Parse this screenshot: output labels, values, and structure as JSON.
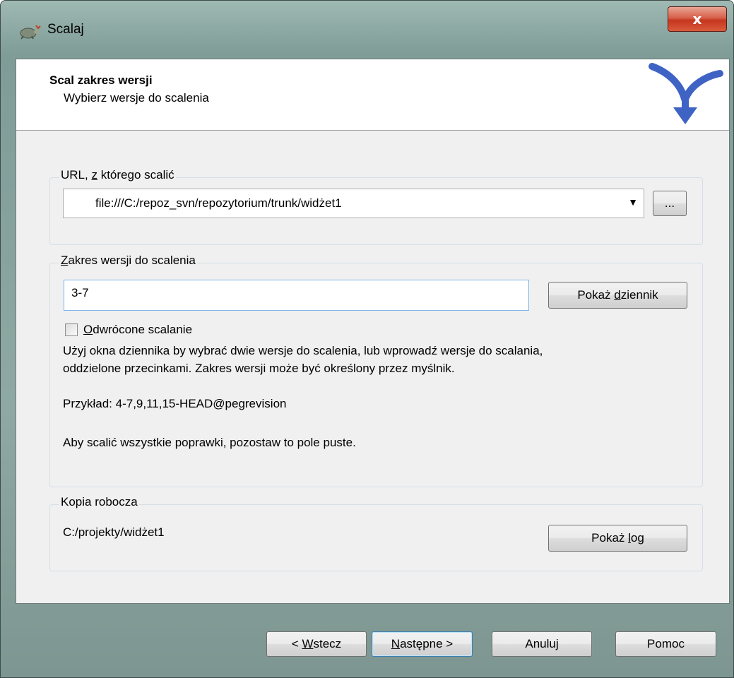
{
  "window": {
    "title": "Scalaj",
    "close_label": "x"
  },
  "header": {
    "title": "Scal zakres wersji",
    "subtitle": "Wybierz wersje do scalenia"
  },
  "url_group": {
    "label_pre": "URL, ",
    "label_accel": "z",
    "label_post": " którego scalić",
    "value": "file:///C:/repoz_svn/repozytorium/trunk/widżet1",
    "browse_label": "..."
  },
  "range_group": {
    "label_accel": "Z",
    "label_post": "akres wersji do scalenia",
    "value": "3-7",
    "show_log_pre": "Pokaż ",
    "show_log_accel": "d",
    "show_log_post": "ziennik",
    "reverse_accel": "O",
    "reverse_post": "dwrócone scalanie",
    "help_line1": "Użyj okna dziennika by wybrać dwie wersje do scalenia, lub wprowadź wersje do scalania,",
    "help_line2": "oddzielone przecinkami. Zakres wersji może być określony przez myślnik.",
    "example": "Przykład: 4-7,9,11,15-HEAD@pegrevision",
    "empty_hint": "Aby scalić wszystkie poprawki, pozostaw to pole puste."
  },
  "wc_group": {
    "label": "Kopia robocza",
    "path": "C:/projekty/widżet1",
    "show_log_pre": "Pokaż ",
    "show_log_accel": "l",
    "show_log_post": "og"
  },
  "footer": {
    "back_pre": "< ",
    "back_accel": "W",
    "back_post": "stecz",
    "next_accel": "N",
    "next_post": "astępne >",
    "cancel": "Anuluj",
    "help": "Pomoc"
  }
}
